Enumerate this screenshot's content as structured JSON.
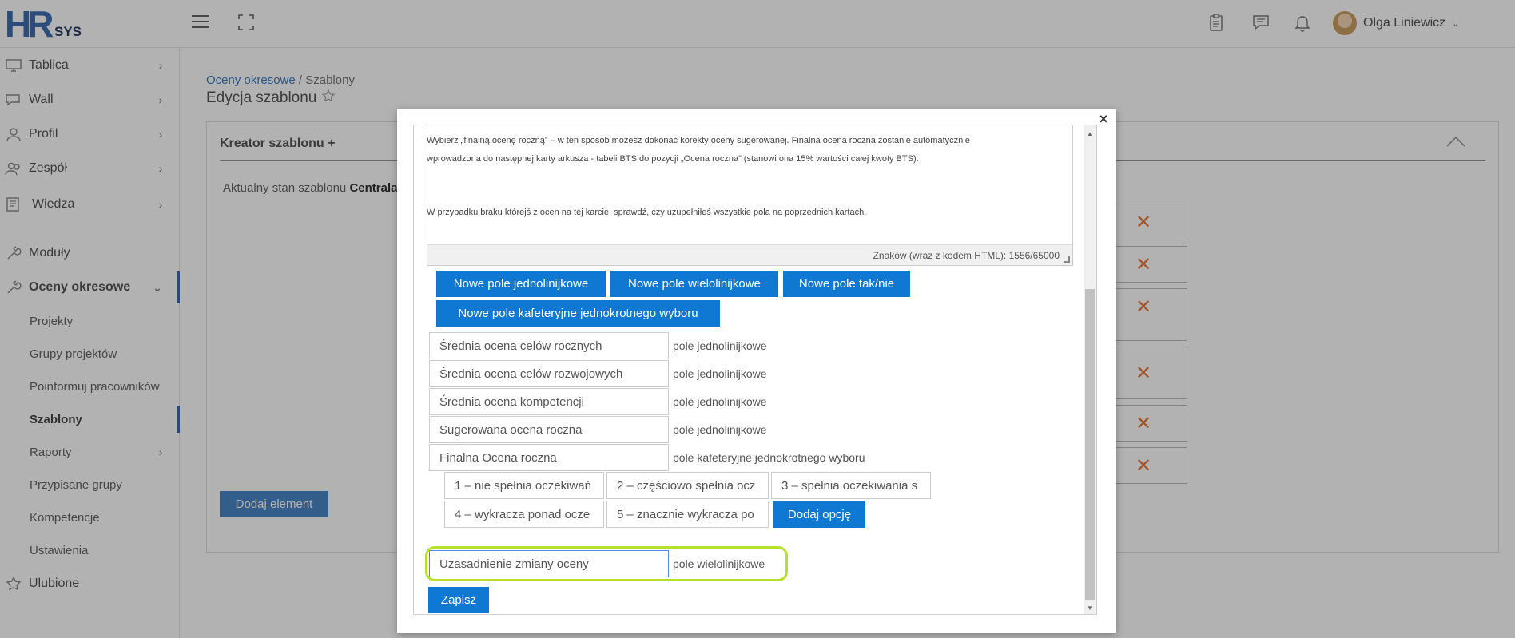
{
  "header": {
    "logo_main": "HR",
    "logo_sub": "SYS",
    "user_name": "Olga Liniewicz"
  },
  "sidebar": {
    "items": [
      {
        "label": "Tablica"
      },
      {
        "label": "Wall"
      },
      {
        "label": "Profil"
      },
      {
        "label": "Zespół"
      },
      {
        "label": "Wiedza"
      },
      {
        "label": "Moduły"
      },
      {
        "label": "Oceny okresowe"
      },
      {
        "label": "Ulubione"
      }
    ],
    "subitems": [
      {
        "label": "Projekty"
      },
      {
        "label": "Grupy projektów"
      },
      {
        "label": "Poinformuj pracowników"
      },
      {
        "label": "Szablony"
      },
      {
        "label": "Raporty"
      },
      {
        "label": "Przypisane grupy"
      },
      {
        "label": "Kompetencje"
      },
      {
        "label": "Ustawienia"
      }
    ]
  },
  "page": {
    "breadcrumb_link": "Oceny okresowe",
    "breadcrumb_sep": " / ",
    "breadcrumb_current": "Szablony",
    "title": "Edycja szablonu",
    "card_title": "Kreator szablonu +",
    "status_prefix": "Aktualny stan szablonu ",
    "status_value": "Centrala",
    "add_element_label": "Dodaj element",
    "remove_glyph": "✕"
  },
  "modal": {
    "close_glyph": "×",
    "editor": {
      "line1": "Wybierz „finalną ocenę roczną” – w ten sposób możesz dokonać korekty oceny sugerowanej. Finalna ocena roczna zostanie automatycznie",
      "line2": "wprowadzona do następnej karty arkusza - tabeli BTS do pozycji „Ocena roczna” (stanowi ona 15% wartości całej kwoty BTS).",
      "line3": "W przypadku braku którejś z ocen na tej karcie, sprawdź, czy uzupełniłeś wszystkie pola na poprzednich kartach.",
      "char_count": "Znaków (wraz z kodem HTML): 1556/65000"
    },
    "buttons": {
      "single_line": "Nowe pole jednolinijkowe",
      "multi_line": "Nowe pole wielolinijkowe",
      "yes_no": "Nowe pole tak/nie",
      "cafeteria": "Nowe pole kafeteryjne jednokrotnego wyboru",
      "add_option": "Dodaj opcję",
      "save": "Zapisz"
    },
    "fields": [
      {
        "name": "Średnia ocena celów rocznych",
        "type": "pole jednolinijkowe"
      },
      {
        "name": "Średnia ocena celów rozwojowych",
        "type": "pole jednolinijkowe"
      },
      {
        "name": "Średnia ocena kompetencji",
        "type": "pole jednolinijkowe"
      },
      {
        "name": "Sugerowana ocena roczna",
        "type": "pole jednolinijkowe"
      },
      {
        "name": "Finalna Ocena roczna",
        "type": "pole kafeteryjne jednokrotnego wyboru"
      },
      {
        "name": "Uzasadnienie zmiany oceny",
        "type": "pole wielolinijkowe"
      }
    ],
    "options": [
      "1 – nie spełnia oczekiwań",
      "2 – częściowo spełnia ocz",
      "3 – spełnia oczekiwania s",
      "4 – wykracza ponad ocze",
      "5 – znacznie wykracza po"
    ]
  }
}
